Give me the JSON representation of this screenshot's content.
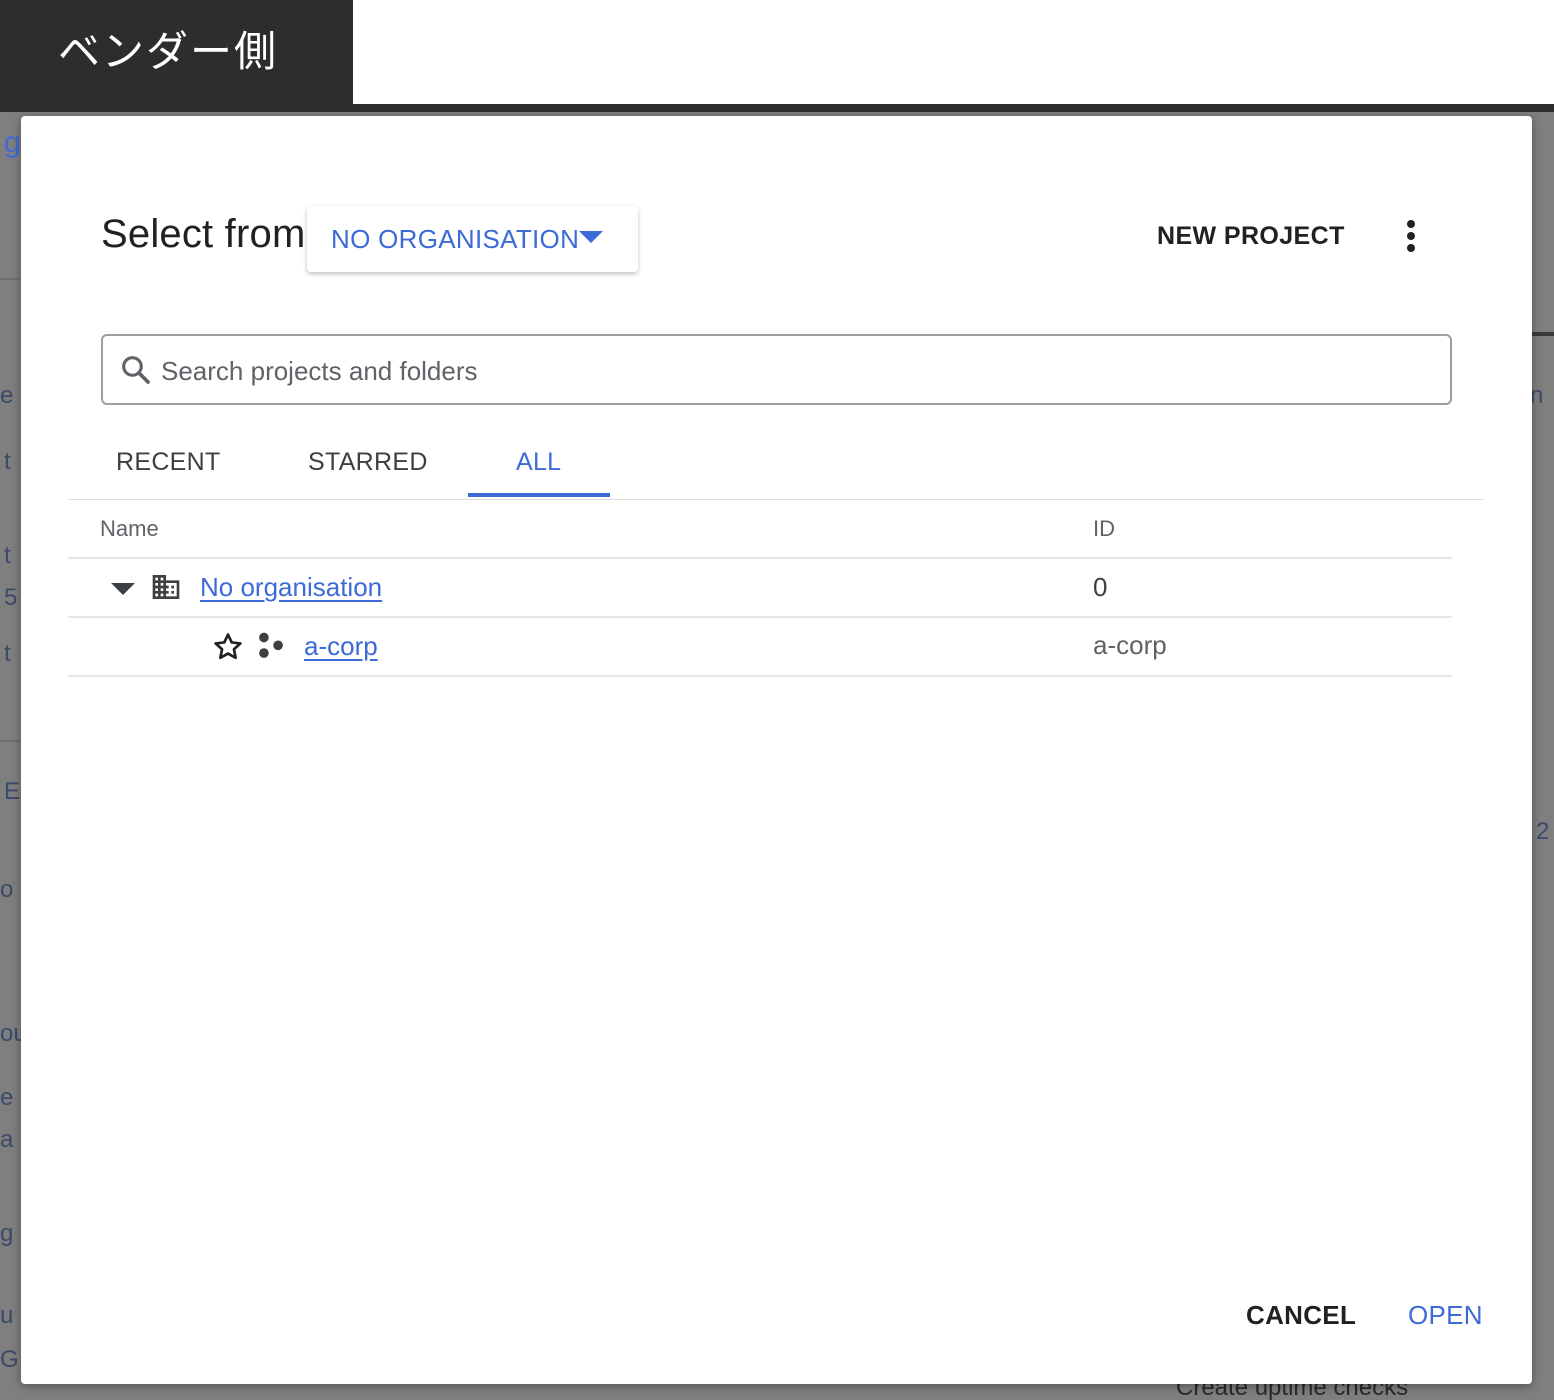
{
  "overlay_label": "ベンダー側",
  "background_fragments": [
    "g",
    "e",
    "t",
    "t",
    "5",
    "t",
    "E",
    "o",
    "ou",
    "e",
    "a",
    "g",
    "u",
    "G",
    "n",
    "2",
    "Create uptime checks"
  ],
  "dialog": {
    "title": "Select from",
    "organisation_selector": "NO ORGANISATION",
    "new_project_label": "NEW PROJECT",
    "search": {
      "placeholder": "Search projects and folders",
      "value": ""
    },
    "tabs": [
      {
        "label": "RECENT",
        "active": false
      },
      {
        "label": "STARRED",
        "active": false
      },
      {
        "label": "ALL",
        "active": true
      }
    ],
    "table": {
      "columns": [
        "Name",
        "ID"
      ],
      "rows": [
        {
          "type": "organisation",
          "name": "No organisation",
          "id": "0",
          "expanded": true,
          "icon": "building-icon"
        },
        {
          "type": "project",
          "name": "a-corp",
          "id": "a-corp",
          "starred": false,
          "icon": "project-icon"
        }
      ]
    },
    "buttons": {
      "cancel": "CANCEL",
      "open": "OPEN"
    }
  },
  "colors": {
    "accent": "#3c6ad6",
    "text": "#202124",
    "muted": "#5f6368",
    "overlay": "#2d2d2d"
  }
}
